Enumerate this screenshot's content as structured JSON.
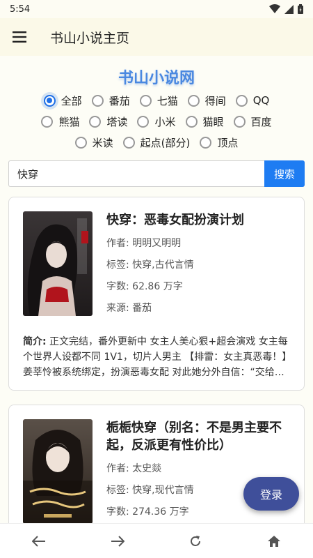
{
  "status_bar": {
    "time": "5:54"
  },
  "app_bar": {
    "title": "书山小说主页"
  },
  "brand": {
    "title": "书山小说网"
  },
  "sources": {
    "row1": [
      {
        "label": "全部",
        "checked": true
      },
      {
        "label": "番茄",
        "checked": false
      },
      {
        "label": "七猫",
        "checked": false
      },
      {
        "label": "得间",
        "checked": false
      },
      {
        "label": "QQ",
        "checked": false
      }
    ],
    "row2": [
      {
        "label": "熊猫",
        "checked": false
      },
      {
        "label": "塔读",
        "checked": false
      },
      {
        "label": "小米",
        "checked": false
      },
      {
        "label": "猫眼",
        "checked": false
      },
      {
        "label": "百度",
        "checked": false
      }
    ],
    "row3": [
      {
        "label": "米读",
        "checked": false
      },
      {
        "label": "起点(部分)",
        "checked": false
      },
      {
        "label": "顶点",
        "checked": false
      }
    ]
  },
  "search": {
    "value": "快穿",
    "button_label": "搜索"
  },
  "books": [
    {
      "title": "快穿：恶毒女配扮演计划",
      "author": "作者: 明明又明明",
      "tags": "标签: 快穿,古代言情",
      "words": "字数: 62.86 万字",
      "source": "来源: 番茄",
      "intro_label": "简介:",
      "intro": " 正文完结，番外更新中 女主人美心狠+超会演戏 女主每个世界人设都不同 1V1，切片人男主 【排雷：女主真恶毒！】姜莘怜被系统绑定，扮演恶毒女配 对此她分外自信：“交给我吧，不就是恶毒女配嘛，我最擅长了！”"
    },
    {
      "title": "栀栀快穿（别名：不是男主要不起，反派更有性价比）",
      "author": "作者: 太史燚",
      "tags": "标签: 快穿,现代言情",
      "words": "字数: 274.36 万字"
    }
  ],
  "fab": {
    "login_label": "登录"
  },
  "icons": {
    "menu": "menu-icon",
    "back": "arrow-left-icon",
    "forward": "arrow-right-icon",
    "refresh": "refresh-icon",
    "home": "home-icon"
  },
  "colors": {
    "accent": "#1e7cf2",
    "fab": "#3f4f9a",
    "brand": "#4a88e0"
  }
}
